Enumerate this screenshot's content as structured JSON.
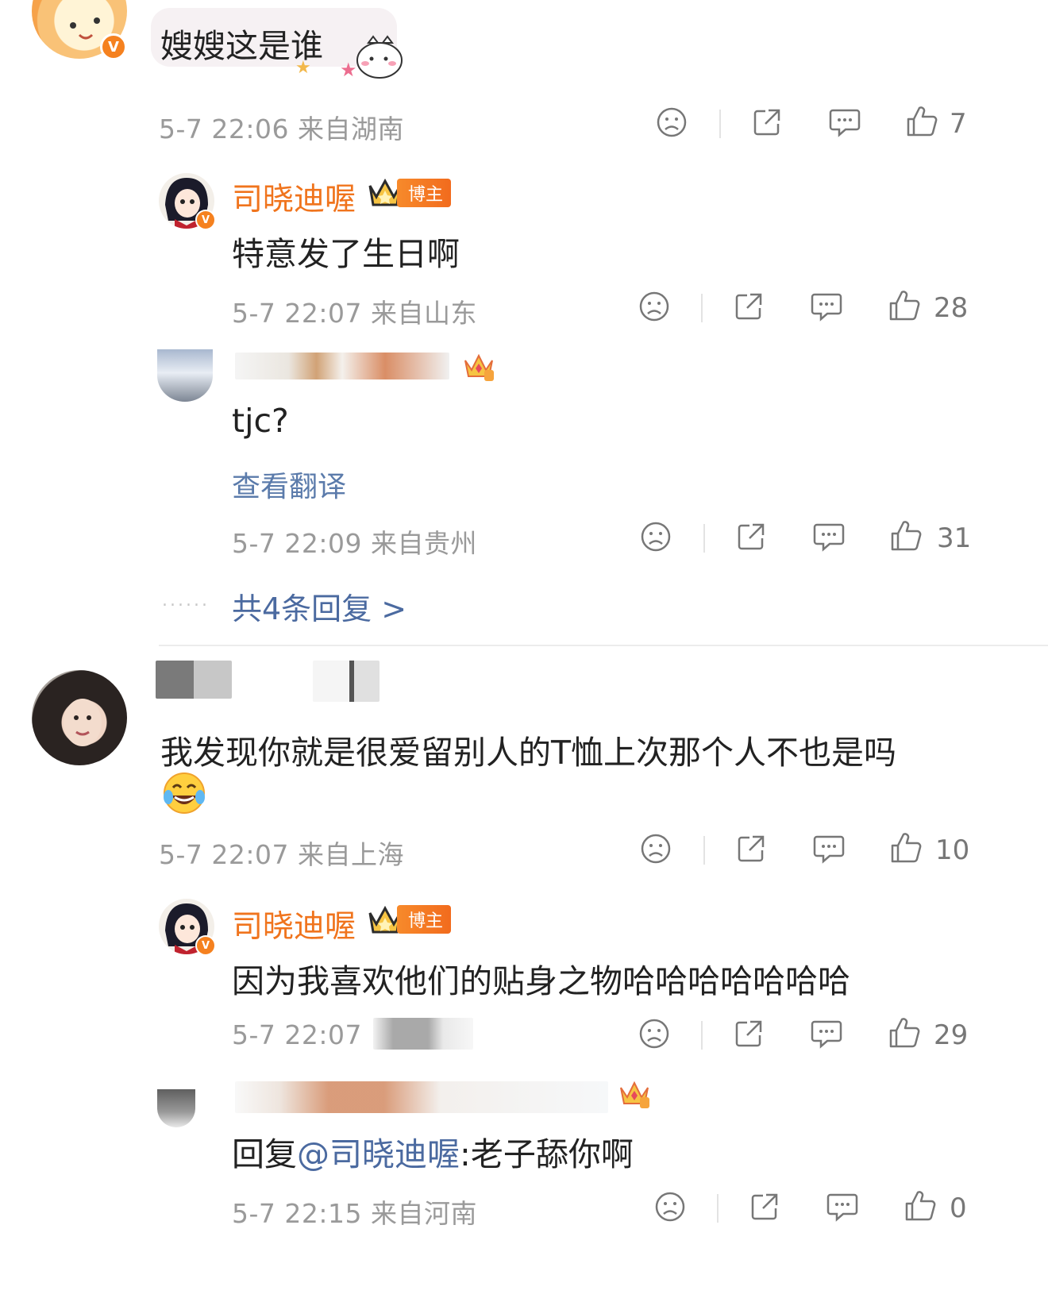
{
  "comments": [
    {
      "text": "嫂嫂这是谁",
      "meta": "5-7 22:06 来自湖南",
      "likes": "7",
      "verified": "V"
    },
    {
      "name": "",
      "text": "我发现你就是很爱留别人的T恤上次那个人不也是吗",
      "meta": "5-7 22:07 来自上海",
      "likes": "10"
    }
  ],
  "replies": [
    {
      "name": "司晓迪喔",
      "badge": "博主",
      "text": "特意发了生日啊",
      "meta": "5-7 22:07 来自山东",
      "likes": "28",
      "verified": "V"
    },
    {
      "name": "",
      "text": "tjc?",
      "translate": "查看翻译",
      "meta": "5-7 22:09 来自贵州",
      "likes": "31"
    },
    {
      "name": "司晓迪喔",
      "badge": "博主",
      "text": "因为我喜欢他们的贴身之物哈哈哈哈哈哈哈",
      "meta": "5-7 22:07",
      "likes": "29",
      "verified": "V"
    },
    {
      "name": "",
      "reply_prefix": "回复",
      "mention": "@司晓迪喔",
      "reply_text": ":老子舔你啊",
      "meta": "5-7 22:15 来自河南",
      "likes": "0"
    }
  ],
  "more_replies": "共4条回复 >",
  "more_dots": "......",
  "colors": {
    "accent_orange": "#f0741d",
    "link_blue": "#4b6aa0",
    "meta_gray": "#9a9a9a"
  },
  "icons": [
    "dislike-icon",
    "share-icon",
    "comment-icon",
    "like-icon",
    "laugh-emoji",
    "cat-sticker",
    "crown-icon"
  ]
}
